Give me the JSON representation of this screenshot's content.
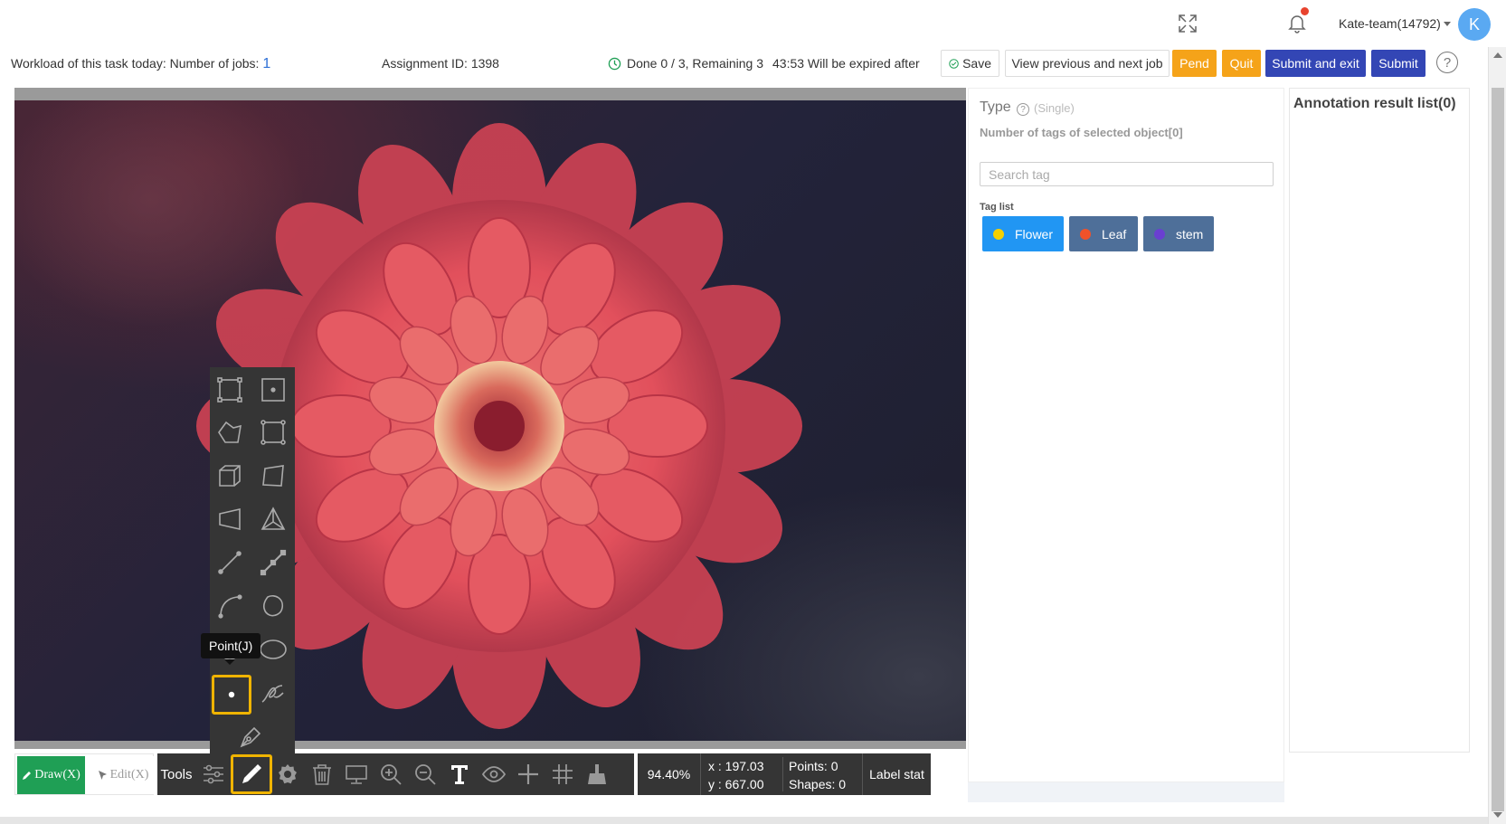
{
  "header": {
    "user_name": "Kate-team(14792)",
    "avatar_initial": "K",
    "icons": [
      "fullscreen-icon",
      "bell-icon",
      "caret-down-icon"
    ]
  },
  "task": {
    "workload_label": "Workload of this task today: Number of jobs:",
    "jobs_count": "1",
    "assignment": "Assignment ID: 1398",
    "progress": "Done 0 / 3, Remaining 3",
    "expiry": "43:53 Will be expired after"
  },
  "actions": {
    "save": "Save",
    "view_prev_next": "View previous and next job",
    "pend": "Pend",
    "quit": "Quit",
    "submit_exit": "Submit and exit",
    "submit": "Submit"
  },
  "toolbox": {
    "tooltip": "Point(J)",
    "tools": [
      "rectangle-tool-icon",
      "center-point-rect-tool-icon",
      "polygon-tool-icon",
      "corner-rect-tool-icon",
      "cuboid-tool-icon",
      "quadrilateral-tool-icon",
      "trapezoid-tool-icon",
      "triangle-tool-icon",
      "line-tool-icon",
      "polyline-tool-icon",
      "curve-tool-icon",
      "closed-curve-tool-icon",
      "circle-tool-icon",
      "ellipse-tool-icon",
      "point-tool-icon",
      "freehand-curve-tool-icon",
      "pen-tool-icon"
    ],
    "selected": "point-tool-icon"
  },
  "bottom": {
    "draw": "Draw(X)",
    "edit": "Edit(X)",
    "tools_label": "Tools",
    "zoom": "94.40%",
    "x_coord": "x : 197.03",
    "y_coord": "y : 667.00",
    "points": "Points:  0",
    "shapes": "Shapes:  0",
    "label_stat": "Label stat"
  },
  "type_panel": {
    "title": "Type",
    "mode": "(Single)",
    "selected_count": "Number of tags of selected object[0]",
    "search_placeholder": "Search tag",
    "taglist_label": "Tag list",
    "tags": [
      {
        "label": "Flower",
        "dot": "#f5d000",
        "bg": "#2196f3"
      },
      {
        "label": "Leaf",
        "dot": "#f0522a",
        "bg": "#4e6f99"
      },
      {
        "label": "stem",
        "dot": "#6a3fd1",
        "bg": "#4e6f99"
      }
    ]
  },
  "result_panel": {
    "title": "Annotation result list(0)"
  },
  "colors": {
    "draw_green": "#1f9f55",
    "accent_blue": "#3346b5",
    "pend_orange": "#f5a319",
    "tool_highlight": "#f0b400"
  }
}
